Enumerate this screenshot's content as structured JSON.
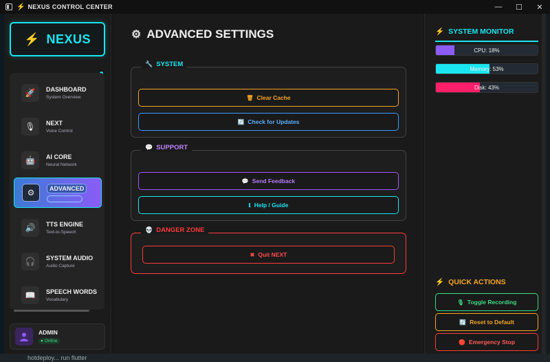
{
  "window": {
    "title": "NEXUS CONTROL CENTER",
    "controls": {
      "minimize": "—",
      "maximize": "☐",
      "close": "✕"
    }
  },
  "sidebar": {
    "logo_text": "NEXUS",
    "items": [
      {
        "label": "DASHBOARD",
        "sub": "System Overview",
        "icon": "🚀"
      },
      {
        "label": "NEXT",
        "sub": "Voice Control",
        "icon": "🎙"
      },
      {
        "label": "AI CORE",
        "sub": "Neural Network",
        "icon": "🤖"
      },
      {
        "label": "ADVANCED",
        "sub": "",
        "icon": "⚙"
      },
      {
        "label": "TTS ENGINE",
        "sub": "Text-to-Speech",
        "icon": "🔊"
      },
      {
        "label": "SYSTEM AUDIO",
        "sub": "Audio Capture",
        "icon": "🎧"
      },
      {
        "label": "SPEECH WORDS",
        "sub": "Vocabulary",
        "icon": "📖"
      }
    ],
    "active_index": 3,
    "user": {
      "name": "ADMIN",
      "status": "● Online"
    }
  },
  "main": {
    "title": "ADVANCED SETTINGS",
    "sections": {
      "system": {
        "heading": "SYSTEM",
        "clear_cache": "Clear Cache",
        "check_updates": "Check for Updates"
      },
      "support": {
        "heading": "SUPPORT",
        "send_feedback": "Send Feedback",
        "help": "Help / Guide"
      },
      "danger": {
        "heading": "DANGER ZONE",
        "quit": "Quit NEXT"
      }
    }
  },
  "monitor": {
    "title": "SYSTEM MONITOR",
    "cpu": {
      "label": "CPU: 18%",
      "value": 0.18,
      "color": "#8b5cf6"
    },
    "memory": {
      "label": "Memory: 53%",
      "value": 0.53,
      "color": "#19e6f0"
    },
    "disk": {
      "label": "Disk: 43%",
      "value": 0.43,
      "color": "#ff1f6b"
    }
  },
  "quick_actions": {
    "title": "QUICK ACTIONS",
    "toggle_recording": "Toggle Recording",
    "reset_default": "Reset to Default",
    "emergency_stop": "Emergency Stop"
  },
  "colors": {
    "accent_cyan": "#19e6f0",
    "accent_orange": "#ff7a1a",
    "orange_btn": "#f5a623",
    "blue_btn": "#3b9cff",
    "purple_btn": "#a259ff",
    "danger": "#ff3b3b",
    "green_btn": "#3ddc84"
  },
  "taskbar": {
    "text": "hotdeploy... run flutter"
  }
}
